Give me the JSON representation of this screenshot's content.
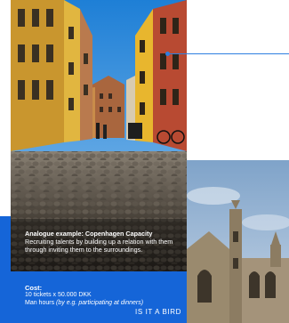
{
  "slide": {
    "caption_title": "Analogue example: Copenhagen Capacity",
    "caption_text": "Recruiting talents by building up a relation with them through inviting them to the surroundings.",
    "cost_label": "Cost:",
    "cost_tickets": "10 tickets x 50.000 DKK",
    "cost_hours": "Man hours ",
    "cost_hours_note": "(by e.g. participating at dinners)",
    "brand": "IS IT A BIRD"
  },
  "colors": {
    "accent": "#1565d8",
    "connector": "#2f7fe0"
  }
}
